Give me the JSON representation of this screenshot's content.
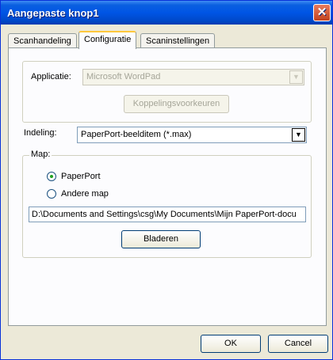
{
  "window": {
    "title": "Aangepaste knop1",
    "close_glyph": "✕"
  },
  "tabs": [
    {
      "label": "Scanhandeling"
    },
    {
      "label": "Configuratie"
    },
    {
      "label": "Scaninstellingen"
    }
  ],
  "applicatie": {
    "label": "Applicatie:",
    "value": "Microsoft WordPad",
    "link_button": "Koppelingsvoorkeuren"
  },
  "indeling": {
    "label": "Indeling:",
    "value": "PaperPort-beelditem (*.max)"
  },
  "map": {
    "legend": "Map:",
    "options": [
      {
        "label": "PaperPort",
        "selected": true
      },
      {
        "label": "Andere map",
        "selected": false
      }
    ],
    "path": "D:\\Documents and Settings\\csg\\My Documents\\Mijn PaperPort-docu",
    "browse_button": "Bladeren"
  },
  "footer": {
    "ok": "OK",
    "cancel": "Cancel"
  },
  "colors": {
    "title_bar": "#0055e5",
    "face": "#ece9d8"
  }
}
